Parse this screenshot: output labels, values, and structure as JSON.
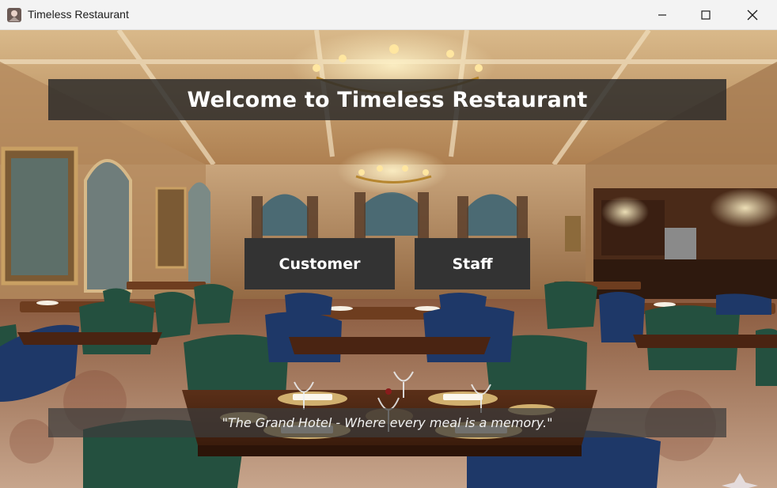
{
  "window": {
    "title": "Timeless Restaurant",
    "icon": "app-window-icon",
    "controls": [
      "minimize-icon",
      "maximize-icon",
      "close-icon"
    ]
  },
  "main": {
    "welcome": "Welcome to Timeless Restaurant",
    "buttons": {
      "customer": "Customer",
      "staff": "Staff"
    },
    "tagline": "\"The Grand Hotel - Where every meal is a memory.\"",
    "background": "restaurant-dining-room-photo"
  },
  "colors": {
    "titlebar": "#f3f3f3",
    "banner": "#282828",
    "button": "#333333",
    "text": "#ffffff"
  }
}
